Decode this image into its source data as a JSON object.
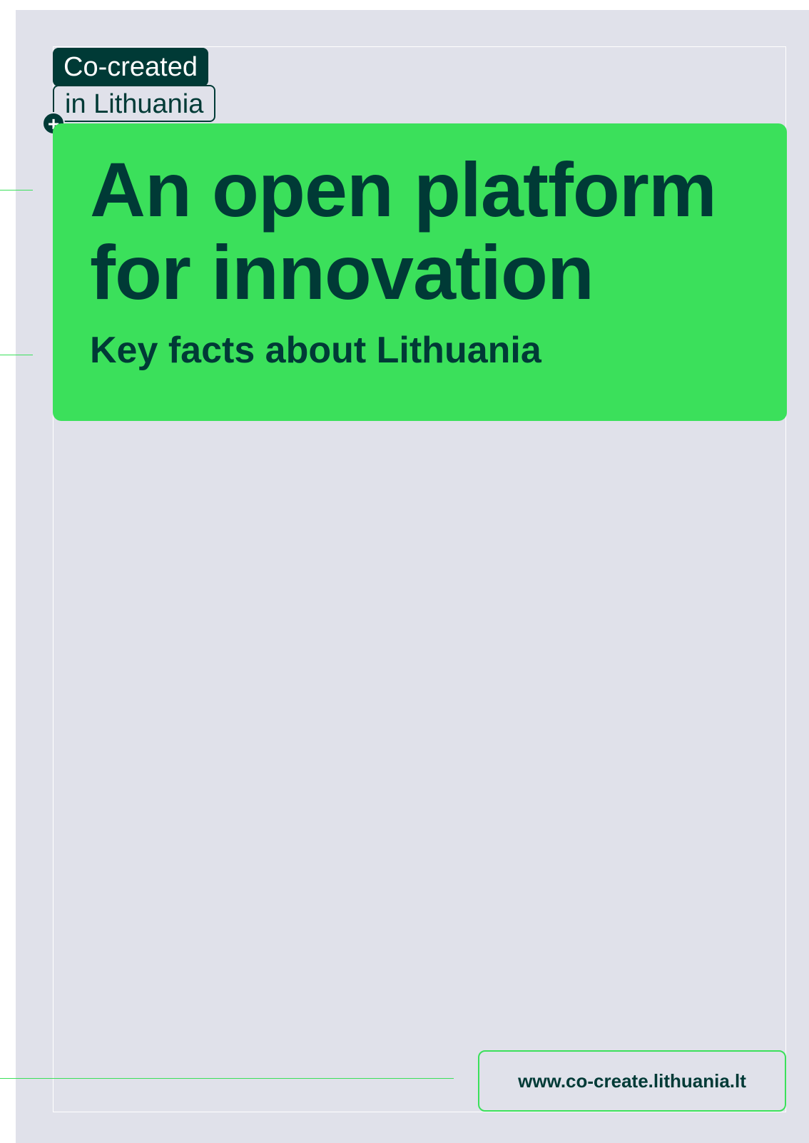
{
  "badge": {
    "line1": "Co-created",
    "line2": "in Lithuania",
    "icon": "plus-icon"
  },
  "hero": {
    "title_line1": "An open platform",
    "title_line2": "for innovation",
    "subtitle": "Key facts about Lithuania"
  },
  "footer": {
    "url": "www.co-create.lithuania.lt"
  },
  "colors": {
    "background": "#e0e1ea",
    "accent_green": "#3be05b",
    "dark_teal": "#003a36"
  }
}
